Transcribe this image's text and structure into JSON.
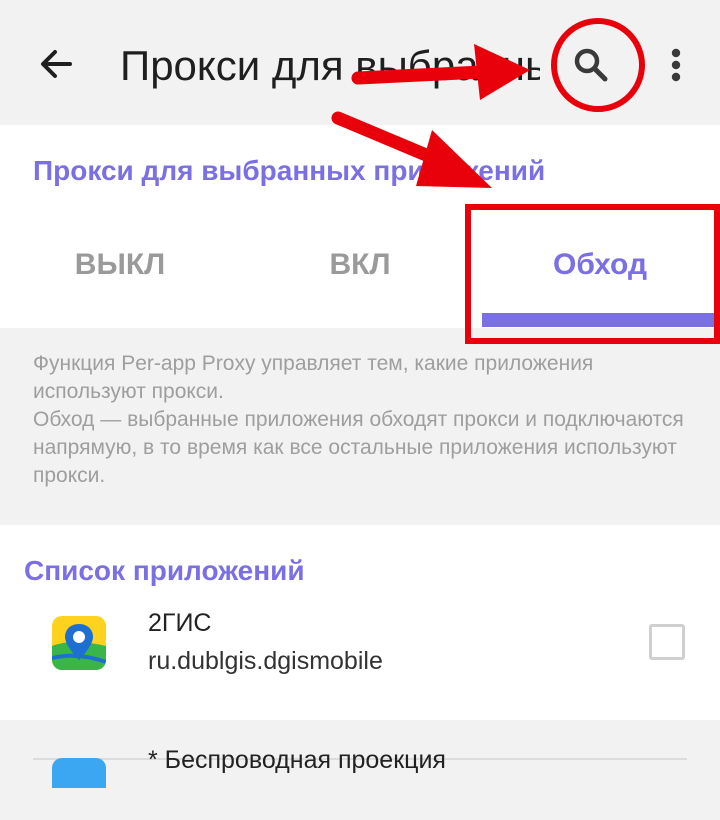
{
  "header": {
    "title": "Прокси для выбранных приложений",
    "icons": [
      "back-arrow-icon",
      "search-icon",
      "more-vert-icon"
    ]
  },
  "mode": {
    "section_title": "Прокси для выбранных приложений",
    "tabs": [
      {
        "label": "ВЫКЛ",
        "selected": false
      },
      {
        "label": "ВКЛ",
        "selected": false
      },
      {
        "label": "Обход",
        "selected": true
      }
    ]
  },
  "description": {
    "line1": "Функция Per-app Proxy управляет тем, какие приложения используют прокси.",
    "line2": "Обход — выбранные приложения обходят прокси и подключаются напрямую, в то время как все остальные приложения используют прокси."
  },
  "app_list": {
    "title": "Список приложений",
    "items": [
      {
        "name": "2ГИС",
        "package": "ru.dublgis.dgismobile",
        "checked": false
      },
      {
        "name": "* Беспроводная проекция",
        "package": ""
      }
    ]
  },
  "colors": {
    "accent": "#7b6fe4",
    "annotation_red": "#e8000b",
    "background": "#f2f2f2"
  }
}
